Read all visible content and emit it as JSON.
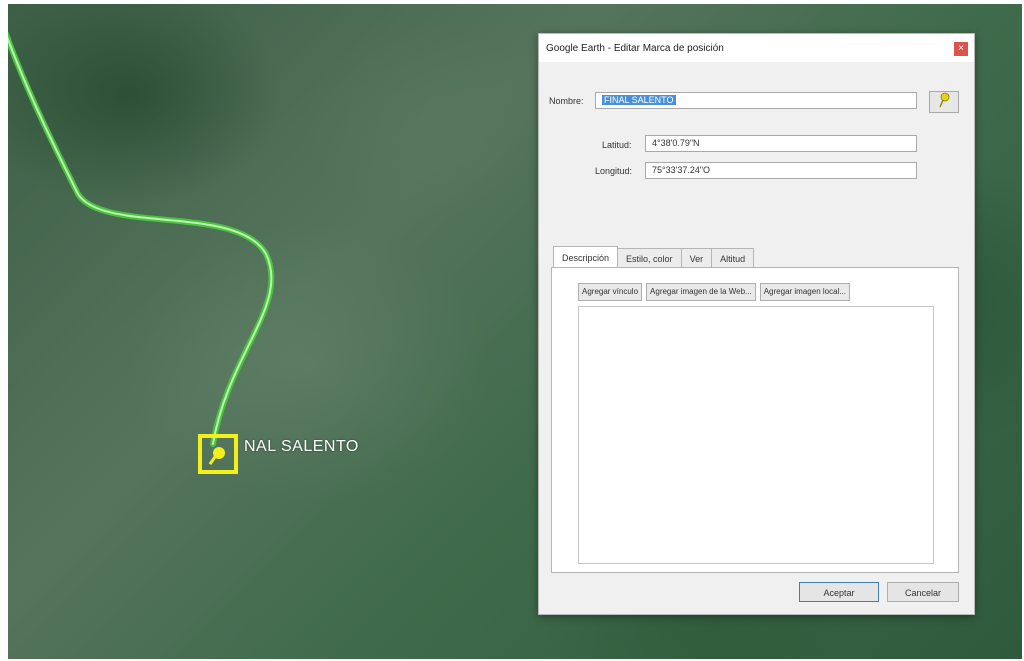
{
  "map": {
    "placemark_label": "NAL SALENTO",
    "path_color": "#48c43c",
    "placemark_color": "#f3ef1a"
  },
  "dialog": {
    "title": "Google Earth - Editar Marca de posición",
    "close_icon": "close-icon",
    "fields": {
      "name_label": "Nombre:",
      "name_value": "FINAL SALENTO",
      "latitude_label": "Latitud:",
      "latitude_value": "4°38'0.79\"N",
      "longitude_label": "Longitud:",
      "longitude_value": "75°33'37.24\"O"
    },
    "icon_button": "pushpin-icon",
    "tabs": [
      {
        "label": "Descripción"
      },
      {
        "label": "Estilo, color"
      },
      {
        "label": "Ver"
      },
      {
        "label": "Altitud"
      }
    ],
    "description_buttons": {
      "link": "Agregar vínculo",
      "web_image": "Agregar imagen de la Web...",
      "local_image": "Agregar imagen local..."
    },
    "buttons": {
      "accept": "Aceptar",
      "cancel": "Cancelar"
    }
  }
}
